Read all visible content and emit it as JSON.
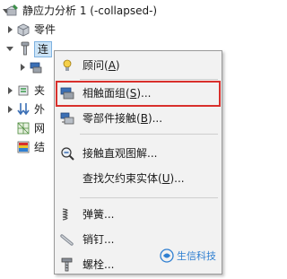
{
  "tree": {
    "study": "静应力分析 1 (-collapsed-)",
    "parts": "零件",
    "connections": "连",
    "fixtures": "夹",
    "external_loads": "外",
    "mesh": "网",
    "results": "结"
  },
  "menu": {
    "items": [
      {
        "text": "顾问",
        "accel": "A",
        "suffix": ")"
      },
      {
        "text": "相触面组",
        "accel": "S",
        "suffix": ")..."
      },
      {
        "text": "零部件接触",
        "accel": "B",
        "suffix": ")..."
      },
      {
        "text": "接触直观图解..."
      },
      {
        "text": "查找欠约束实体",
        "accel": "U",
        "suffix": ")..."
      },
      {
        "text": "弹簧..."
      },
      {
        "text": "销钉..."
      },
      {
        "text": "螺栓..."
      }
    ]
  },
  "watermark": "生信科技",
  "colors": {
    "highlight_border": "#d9302c",
    "menu_bg": "#f2f2f2",
    "watermark_blue": "#2f7fd1"
  }
}
